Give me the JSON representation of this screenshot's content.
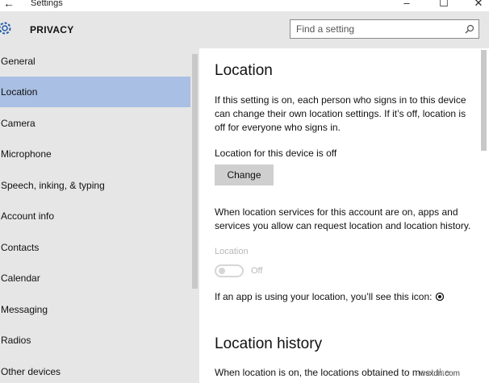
{
  "titlebar": {
    "back_icon": "back-arrow-icon",
    "title": "Settings"
  },
  "header": {
    "title": "PRIVACY",
    "icon": "gear-icon",
    "search_placeholder": "Find a setting"
  },
  "sidebar": {
    "items": [
      {
        "label": "General"
      },
      {
        "label": "Location",
        "selected": true
      },
      {
        "label": "Camera"
      },
      {
        "label": "Microphone"
      },
      {
        "label": "Speech, inking, & typing"
      },
      {
        "label": "Account info"
      },
      {
        "label": "Contacts"
      },
      {
        "label": "Calendar"
      },
      {
        "label": "Messaging"
      },
      {
        "label": "Radios"
      },
      {
        "label": "Other devices"
      }
    ]
  },
  "main": {
    "title": "Location",
    "description": "If this setting is on, each person who signs in to this device can change their own location settings. If it’s off, location is off for everyone who signs in.",
    "device_status": "Location for this device is off",
    "change_label": "Change",
    "services_text": "When location services for this account are on, apps and services you allow can request location and location history.",
    "location_label": "Location",
    "toggle_state": "Off",
    "icon_note": "If an app is using your location, you’ll see this icon:",
    "history_title": "Location history",
    "history_text": "When location is on, the locations obtained to meet the"
  },
  "watermark": "wsxdn.com",
  "colors": {
    "selected": "#a9bfe3",
    "panel": "#e6e6e6",
    "disabled": "#b8b8b8"
  }
}
